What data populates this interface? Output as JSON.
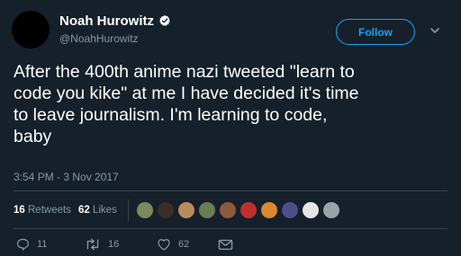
{
  "author": {
    "name": "Noah Hurowitz",
    "handle": "@NoahHurowitz",
    "verified": true
  },
  "follow_button": {
    "label": "Follow"
  },
  "tweet": {
    "text": "After the 400th anime nazi tweeted \"learn to\ncode you kike\" at me I have decided it's time\nto leave journalism. I'm learning to code,\nbaby",
    "timestamp": "3:54 PM - 3 Nov 2017"
  },
  "stats": {
    "retweets_count": "16",
    "retweets_label": "Retweets",
    "likes_count": "62",
    "likes_label": "Likes"
  },
  "liker_avatars": [
    {
      "color": "#7a8a5c"
    },
    {
      "color": "#3b2e2a"
    },
    {
      "color": "#b98c5a"
    },
    {
      "color": "#6b7d52"
    },
    {
      "color": "#8c5a3c"
    },
    {
      "color": "#c0302b"
    },
    {
      "color": "#d9892e"
    },
    {
      "color": "#4a4f8c"
    },
    {
      "color": "#e6e6e6"
    },
    {
      "color": "#9aa3a9"
    }
  ],
  "actions": {
    "reply_count": "11",
    "retweet_count": "16",
    "like_count": "62"
  },
  "colors": {
    "background": "#15202b",
    "accent": "#1da1f2",
    "muted": "#8899a6",
    "divider": "#38444d"
  },
  "icons": {
    "verified": "verified-badge-icon",
    "caret": "chevron-down-icon",
    "reply": "reply-icon",
    "retweet": "retweet-icon",
    "like": "heart-icon",
    "dm": "envelope-icon"
  }
}
